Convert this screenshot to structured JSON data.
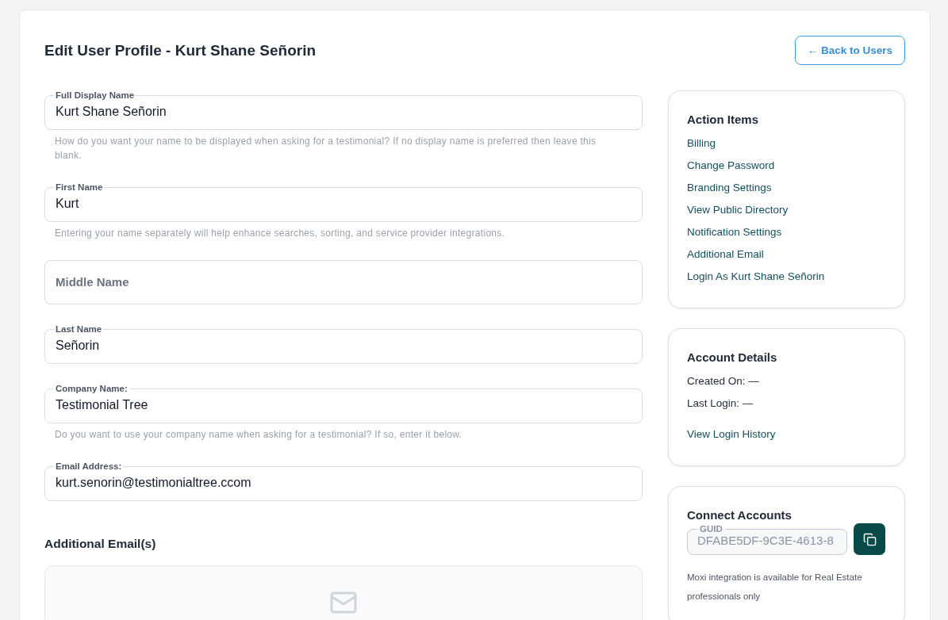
{
  "header": {
    "title": "Edit User Profile - Kurt Shane Señorin",
    "back_button": "← Back to Users"
  },
  "fields": [
    {
      "label": "Full Display Name",
      "value": "Kurt Shane Señorin",
      "hint": "How do you want your name to be displayed when asking for a testimonial? If no display name is preferred then leave this blank."
    },
    {
      "label": "First Name",
      "value": "Kurt",
      "hint": "Entering your name separately will help enhance searches, sorting, and service provider integrations."
    },
    {
      "placeholder": "Middle Name"
    },
    {
      "label": "Last Name",
      "value": "Señorin"
    },
    {
      "label": "Company Name:",
      "value": "Testimonial Tree",
      "hint": "Do you want to use your company name when asking for a testimonial? If so, enter it below."
    },
    {
      "label": "Email Address:",
      "value": "kurt.senorin@testimonialtree.ccom"
    }
  ],
  "additional_emails": {
    "title": "Additional Email(s)"
  },
  "action_items": {
    "title": "Action Items",
    "links": [
      "Billing",
      "Change Password",
      "Branding Settings",
      "View Public Directory",
      "Notification Settings",
      "Additional Email",
      "Login As Kurt Shane Señorin"
    ]
  },
  "account_details": {
    "title": "Account Details",
    "lines": [
      "Created On: —",
      "Last Login: —"
    ],
    "link": "View Login History"
  },
  "connect_accounts": {
    "title": "Connect Accounts",
    "guid_label": "GUID",
    "guid_value": "DFABE5DF-9C3E-4613-8",
    "note": "Moxi integration is available for Real Estate professionals only"
  }
}
